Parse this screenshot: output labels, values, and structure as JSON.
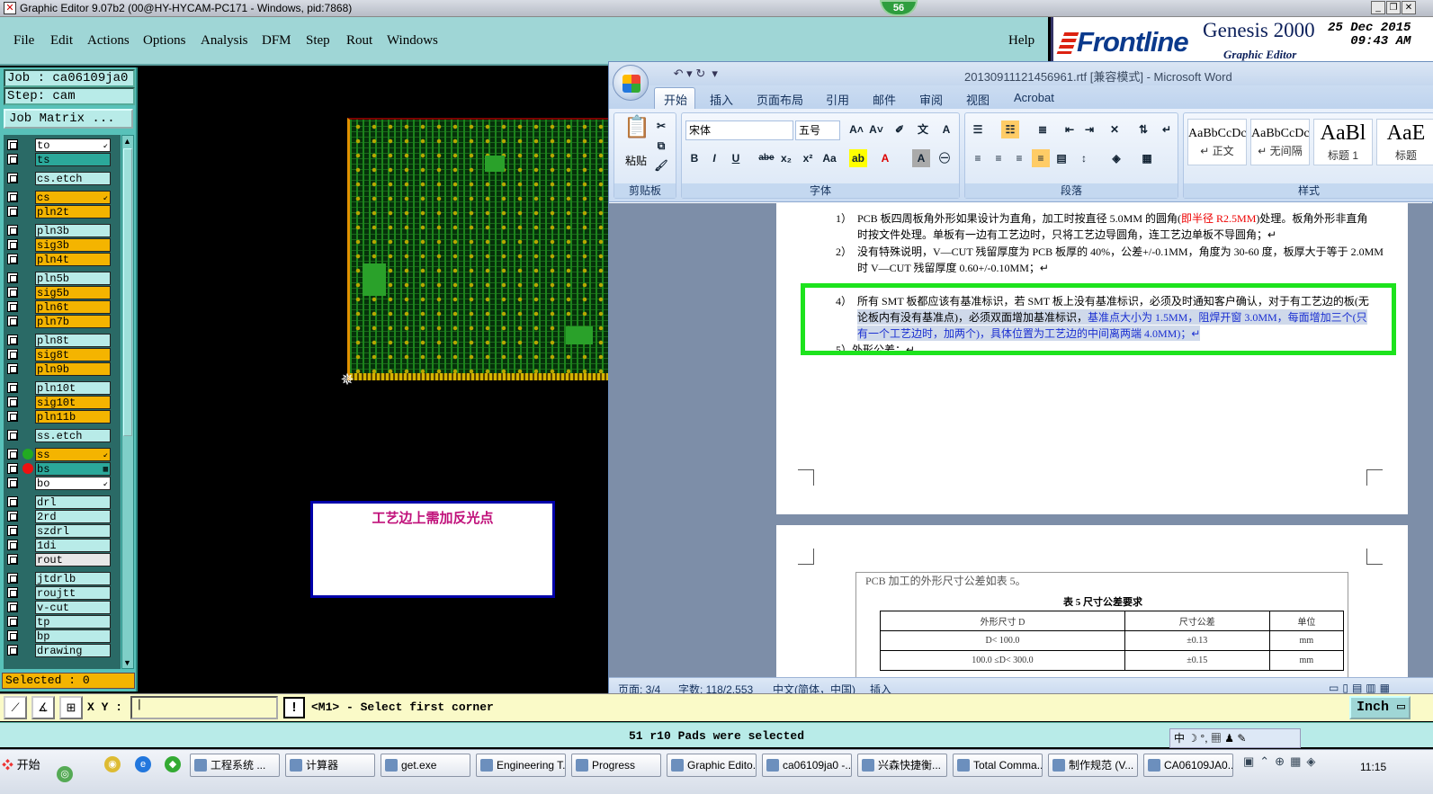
{
  "titlebar": {
    "title": "Graphic Editor 9.07b2 (00@HY-HYCAM-PC171 - Windows, pid:7868)",
    "badge": "56"
  },
  "menu": {
    "items": [
      "File",
      "Edit",
      "Actions",
      "Options",
      "Analysis",
      "DFM",
      "Step",
      "Rout",
      "Windows"
    ],
    "help": "Help"
  },
  "brand": {
    "frontline": "Frontline",
    "genesis": "Genesis 2000",
    "graphic_editor": "Graphic Editor",
    "date": "25 Dec 2015",
    "time": "09:43 AM"
  },
  "job": {
    "job_label": "Job : ca06109ja0",
    "step_label": "Step: cam",
    "job_matrix": "Job Matrix ..."
  },
  "layers": [
    {
      "name": "to",
      "color": "#ffffff",
      "arrow": "↙"
    },
    {
      "name": "ts",
      "color": "#2ba89a"
    },
    {
      "name": "cs.etch",
      "color": "#b8ebe8"
    },
    {
      "name": "cs",
      "color": "#f4b400",
      "arrow": "↙"
    },
    {
      "name": "pln2t",
      "color": "#f4b400"
    },
    {
      "name": "pln3b",
      "color": "#b8ebe8"
    },
    {
      "name": "sig3b",
      "color": "#f4b400"
    },
    {
      "name": "pln4t",
      "color": "#f4b400"
    },
    {
      "name": "pln5b",
      "color": "#b8ebe8"
    },
    {
      "name": "sig5b",
      "color": "#f4b400"
    },
    {
      "name": "pln6t",
      "color": "#f4b400"
    },
    {
      "name": "pln7b",
      "color": "#f4b400"
    },
    {
      "name": "pln8t",
      "color": "#b8ebe8"
    },
    {
      "name": "sig8t",
      "color": "#f4b400"
    },
    {
      "name": "pln9b",
      "color": "#f4b400"
    },
    {
      "name": "pln10t",
      "color": "#b8ebe8"
    },
    {
      "name": "sig10t",
      "color": "#f4b400"
    },
    {
      "name": "pln11b",
      "color": "#f4b400"
    },
    {
      "name": "ss.etch",
      "color": "#b8ebe8"
    },
    {
      "name": "ss",
      "color": "#f4b400",
      "arrow": "↙",
      "dot": "#22aa22"
    },
    {
      "name": "bs",
      "color": "#2ba89a",
      "arrow": "▦",
      "dot": "#ee1111"
    },
    {
      "name": "bo",
      "color": "#ffffff",
      "arrow": "↙"
    },
    {
      "name": "drl",
      "color": "#b8ebe8"
    },
    {
      "name": "2rd",
      "color": "#b8ebe8"
    },
    {
      "name": "szdrl",
      "color": "#b8ebe8"
    },
    {
      "name": "1di",
      "color": "#b8ebe8"
    },
    {
      "name": "rout",
      "color": "#e8e8e8"
    },
    {
      "name": "jtdrlb",
      "color": "#b8ebe8"
    },
    {
      "name": "roujtt",
      "color": "#b8ebe8"
    },
    {
      "name": "v-cut",
      "color": "#b8ebe8"
    },
    {
      "name": "tp",
      "color": "#b8ebe8"
    },
    {
      "name": "bp",
      "color": "#b8ebe8"
    },
    {
      "name": "drawing",
      "color": "#b8ebe8"
    }
  ],
  "selected": "Selected : 0",
  "canvas": {
    "note": "工艺边上需加反光点"
  },
  "word": {
    "title": "20130911121456961.rtf [兼容模式] - Microsoft Word",
    "tabs": [
      "开始",
      "插入",
      "页面布局",
      "引用",
      "邮件",
      "审阅",
      "视图",
      "Acrobat"
    ],
    "clipboard": {
      "paste": "粘贴",
      "group": "剪贴板"
    },
    "font": {
      "name": "宋体",
      "size": "五号",
      "group": "字体"
    },
    "paragraph": {
      "group": "段落"
    },
    "styles": {
      "group": "样式",
      "items": [
        {
          "preview": "AaBbCcDc",
          "name": "↵ 正文"
        },
        {
          "preview": "AaBbCcDc",
          "name": "↵ 无间隔"
        },
        {
          "preview": "AaBl",
          "name": "标题 1"
        },
        {
          "preview": "AaE",
          "name": "标题"
        }
      ]
    },
    "doc": {
      "p1_num": "1）",
      "p1_a": "PCB 板四周板角外形如果设计为直角，加工时按直径 5.0MM 的圆角(",
      "p1_red": "即半径 R2.5MM",
      "p1_b": ")处理。板角外形非直角",
      "p1_c": "时按文件处理。单板有一边有工艺边时，只将工艺边导圆角，连工艺边单板不导圆角；↵",
      "p2_num": "2）",
      "p2_a": "没有特殊说明，V—CUT 残留厚度为 PCB 板厚的 40%，公差+/-0.1MM，角度为 30-60 度，板厚大于等于 2.0MM",
      "p2_b": "时 V—CUT 残留厚度 0.60+/-0.10MM；↵",
      "p4_num": "4）",
      "p4_a": "所有 SMT 板都应该有基准标识，若 SMT 板上没有基准标识，必须及时通知客户确认，对于有工艺边的板(无",
      "p4_b1": "论板内有没有基准点)，必须双面增加基准标识，",
      "p4_b2": "基准点大小为 1.5MM，阻焊开窗 3.0MM，每面增加三个(只",
      "p4_c": "有一个工艺边时，加两个)，具体位置为工艺边的中间离两端 4.0MM)；↵",
      "p5": "5）外形公差：↵",
      "page2_caption": "PCB 加工的外形尺寸公差如表 5。",
      "table_title": "表 5  尺寸公差要求",
      "table_header": [
        "外形尺寸 D",
        "尺寸公差",
        "单位"
      ],
      "table_rows": [
        [
          "D< 100.0",
          "±0.13",
          "mm"
        ],
        [
          "100.0 ≤D< 300.0",
          "±0.15",
          "mm"
        ]
      ]
    },
    "status": {
      "page": "页面: 3/4",
      "words": "字数: 118/2,553",
      "lang": "中文(简体，中国)",
      "mode": "插入"
    }
  },
  "cmd": {
    "xy_label": "X Y :",
    "xy_value": "|",
    "warn": "!",
    "prompt": "<M1> - Select first corner",
    "unit": "Inch"
  },
  "message": "51 r10 Pads were selected",
  "langbar": "中 ☽ °, ▦ ♟ ✎",
  "taskbar": {
    "start": "开始",
    "tasks": [
      "工程系统 ...",
      "计算器",
      "get.exe",
      "Engineering T...",
      "Progress",
      "Graphic Edito...",
      "ca06109ja0 -...",
      "兴森快捷衡...",
      "Total Comma...",
      "制作规范 (V...",
      "CA06109JA0..."
    ],
    "clock": "11:15"
  }
}
